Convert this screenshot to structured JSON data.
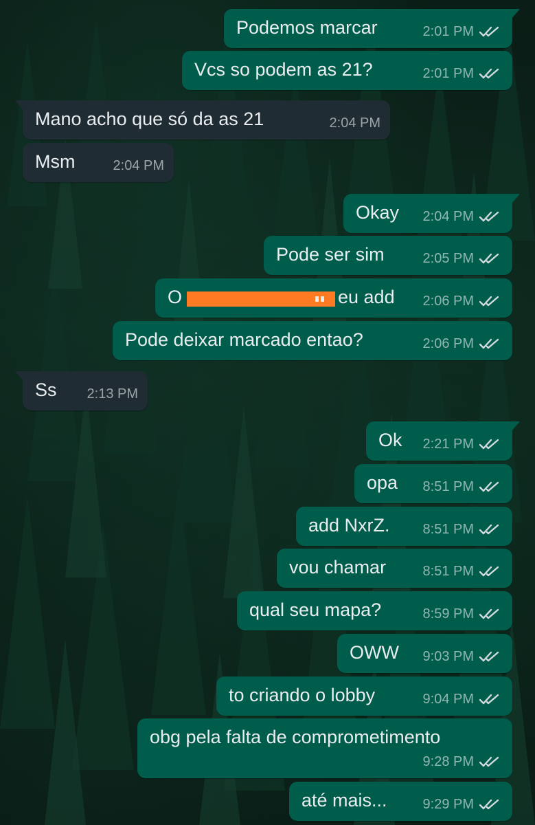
{
  "chat": {
    "messages": [
      {
        "side": "outgoing",
        "text": "Podemos marcar",
        "time": "2:01 PM",
        "status": "read"
      },
      {
        "side": "outgoing",
        "text": "Vcs so podem as 21?",
        "time": "2:01 PM",
        "status": "read"
      },
      {
        "side": "incoming",
        "text": "Mano acho que só da as 21",
        "time": "2:04 PM"
      },
      {
        "side": "incoming",
        "text": "Msm",
        "time": "2:04 PM"
      },
      {
        "side": "outgoing",
        "text": "Okay",
        "time": "2:04 PM",
        "status": "read"
      },
      {
        "side": "outgoing",
        "text": "Pode ser sim",
        "time": "2:05 PM",
        "status": "read"
      },
      {
        "side": "outgoing",
        "text_prefix": "O",
        "text_suffix": "eu add",
        "redacted": true,
        "time": "2:06 PM",
        "status": "read"
      },
      {
        "side": "outgoing",
        "text": "Pode deixar marcado entao?",
        "time": "2:06 PM",
        "status": "read"
      },
      {
        "side": "incoming",
        "text": "Ss",
        "time": "2:13 PM"
      },
      {
        "side": "outgoing",
        "text": "Ok",
        "time": "2:21 PM",
        "status": "read"
      },
      {
        "side": "outgoing",
        "text": "opa",
        "time": "8:51 PM",
        "status": "read"
      },
      {
        "side": "outgoing",
        "text": "add NxrZ.",
        "time": "8:51 PM",
        "status": "read"
      },
      {
        "side": "outgoing",
        "text": "vou chamar",
        "time": "8:51 PM",
        "status": "read"
      },
      {
        "side": "outgoing",
        "text": "qual seu mapa?",
        "time": "8:59 PM",
        "status": "read"
      },
      {
        "side": "outgoing",
        "text": "OWW",
        "time": "9:03 PM",
        "status": "read"
      },
      {
        "side": "outgoing",
        "text": "to criando o lobby",
        "time": "9:04 PM",
        "status": "read"
      },
      {
        "side": "outgoing",
        "text": "obg pela falta de comprometimento",
        "time": "9:28 PM",
        "status": "read"
      },
      {
        "side": "outgoing",
        "text": "até mais...",
        "time": "9:29 PM",
        "status": "read"
      }
    ]
  },
  "icons": {
    "read_ticks": "double-check-icon",
    "background": "pine-forest-wallpaper"
  },
  "colors": {
    "outgoing_bubble": "#005c4b",
    "incoming_bubble": "#1f2c33",
    "message_text": "#e9edef",
    "redaction": "#ff7a22"
  }
}
